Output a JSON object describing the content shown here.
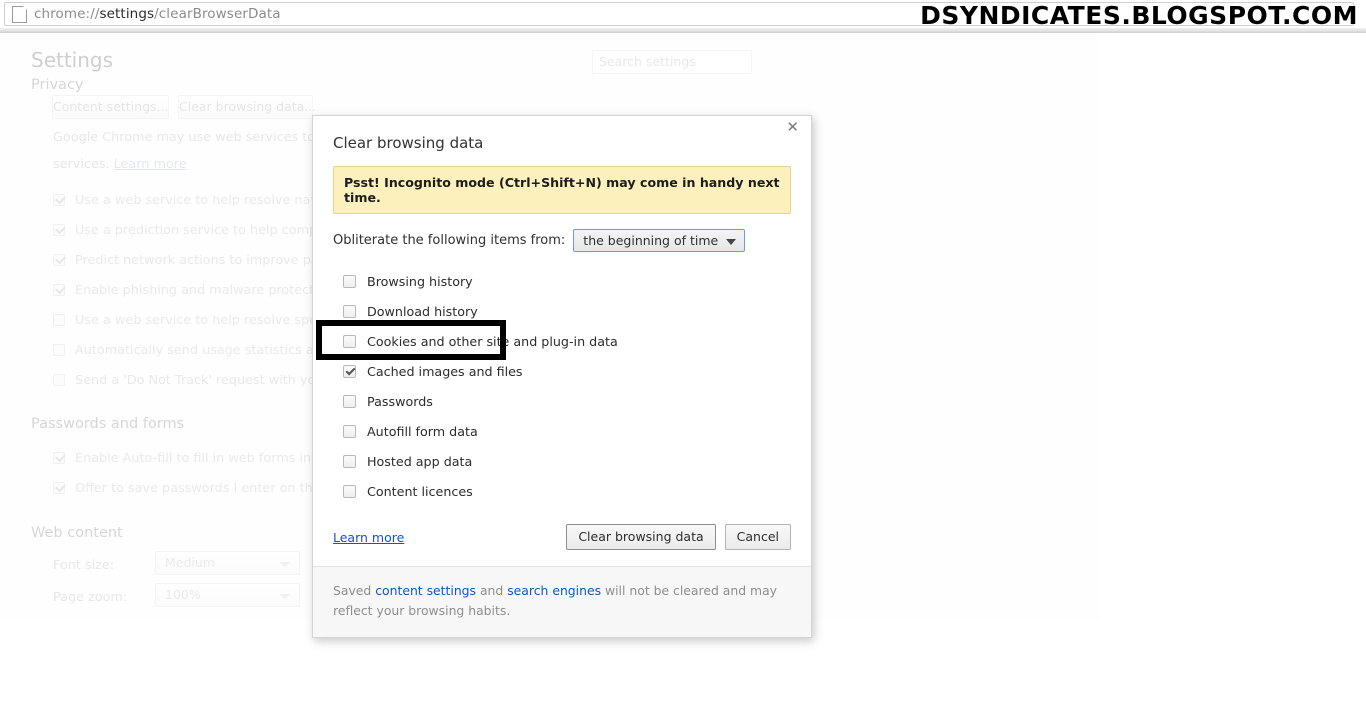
{
  "browser": {
    "url_prefix": "chrome://",
    "url_bold": "settings",
    "url_suffix": "/clearBrowserData",
    "page_icon": "document-icon"
  },
  "watermark": "DSYNDICATES.BLOGSPOT.COM",
  "settings_page": {
    "title": "Settings",
    "search_placeholder": "Search settings",
    "sections": [
      {
        "heading": "Privacy",
        "buttons": [
          "Content settings...",
          "Clear browsing data..."
        ],
        "description": "Google Chrome may use web services to improve",
        "description_line2": "services.",
        "description_link": "Learn more",
        "checkboxes": [
          {
            "label": "Use a web service to help resolve navigation e",
            "checked": true
          },
          {
            "label": "Use a prediction service to help complete sear",
            "checked": true
          },
          {
            "label": "Predict network actions to improve page load",
            "checked": true
          },
          {
            "label": "Enable phishing and malware protection",
            "checked": true
          },
          {
            "label": "Use a web service to help resolve spelling err",
            "checked": false
          },
          {
            "label": "Automatically send usage statistics and crash",
            "checked": false
          },
          {
            "label": "Send a 'Do Not Track' request with your brow",
            "checked": false
          }
        ]
      },
      {
        "heading": "Passwords and forms",
        "checkboxes": [
          {
            "label": "Enable Auto-fill to fill in web forms in a single",
            "checked": true
          },
          {
            "label": "Offer to save passwords I enter on the web.  M",
            "checked": true
          }
        ]
      },
      {
        "heading": "Web content",
        "rows": [
          {
            "label": "Font size:",
            "value": "Medium"
          },
          {
            "label": "Page zoom:",
            "value": "100%"
          }
        ]
      }
    ]
  },
  "dialog": {
    "title": "Clear browsing data",
    "close_icon": "close-icon",
    "notice": "Psst! Incognito mode (Ctrl+Shift+N) may come in handy next time.",
    "obliterate_label": "Obliterate the following items from:",
    "time_range_selected": "the beginning of time",
    "items": [
      {
        "label": "Browsing history",
        "checked": false
      },
      {
        "label": "Download history",
        "checked": false
      },
      {
        "label": "Cookies and other site and plug-in data",
        "checked": false
      },
      {
        "label": "Cached images and files",
        "checked": true
      },
      {
        "label": "Passwords",
        "checked": false
      },
      {
        "label": "Autofill form data",
        "checked": false
      },
      {
        "label": "Hosted app data",
        "checked": false
      },
      {
        "label": "Content licences",
        "checked": false
      }
    ],
    "learn_more": "Learn more",
    "confirm_button": "Clear browsing data",
    "cancel_button": "Cancel",
    "footnote": {
      "part1": "Saved ",
      "link1": "content settings",
      "part2": " and ",
      "link2": "search engines",
      "part3": " will not be cleared and may reflect your browsing habits."
    }
  },
  "annotation": {
    "target": "Cached images and files",
    "color": "#000000"
  }
}
